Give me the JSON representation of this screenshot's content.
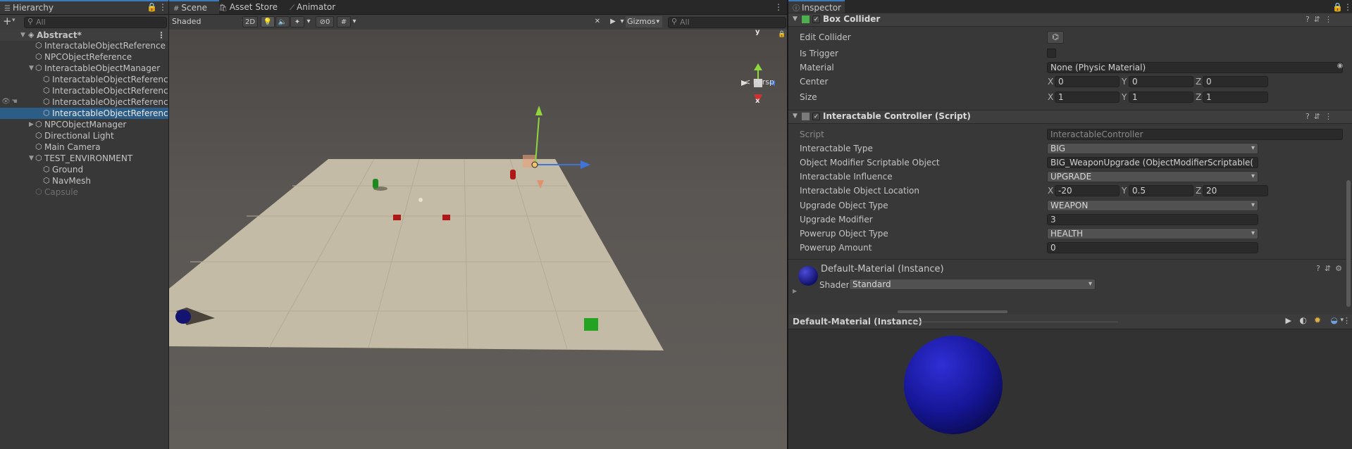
{
  "hierarchy": {
    "tab": "Hierarchy",
    "add": "+",
    "add_caret": "▾",
    "search_placeholder": "All",
    "scene_name": "Abstract*",
    "items": [
      {
        "label": "InteractableObjectReference"
      },
      {
        "label": "NPCObjectReference"
      },
      {
        "label": "InteractableObjectManager"
      },
      {
        "label": "InteractableObjectReference(Clone)"
      },
      {
        "label": "InteractableObjectReference(Clone)"
      },
      {
        "label": "InteractableObjectReference(Clone)"
      },
      {
        "label": "InteractableObjectReference(Clone)"
      },
      {
        "label": "NPCObjectManager"
      },
      {
        "label": "Directional Light"
      },
      {
        "label": "Main Camera"
      },
      {
        "label": "TEST_ENVIRONMENT"
      },
      {
        "label": "Ground"
      },
      {
        "label": "NavMesh"
      },
      {
        "label": "Capsule"
      }
    ]
  },
  "scene": {
    "tabs": [
      {
        "label": "Scene",
        "icon": "#"
      },
      {
        "label": "Asset Store",
        "icon": "🛍"
      },
      {
        "label": "Animator",
        "icon": "⟋"
      }
    ],
    "shading_mode": "Shaded",
    "mode_2d": "2D",
    "hidden_count": "0",
    "gizmos_label": "Gizmos",
    "search_placeholder": "All",
    "persp_label": "< Persp",
    "axis_y": "y",
    "axis_x": "x"
  },
  "inspector": {
    "tab": "Inspector",
    "box_collider": {
      "title": "Box Collider",
      "edit_collider_label": "Edit Collider",
      "is_trigger_label": "Is Trigger",
      "material_label": "Material",
      "material_value": "None (Physic Material)",
      "center_label": "Center",
      "center": {
        "x": "0",
        "y": "0",
        "z": "0"
      },
      "size_label": "Size",
      "size": {
        "x": "1",
        "y": "1",
        "z": "1"
      }
    },
    "controller": {
      "title": "Interactable Controller (Script)",
      "script_label": "Script",
      "script_value": "InteractableController",
      "type_label": "Interactable Type",
      "type_value": "BIG",
      "modifier_label": "Object Modifier Scriptable Object",
      "modifier_value": "BIG_WeaponUpgrade (ObjectModifierScriptable(",
      "influence_label": "Interactable Influence",
      "influence_value": "UPGRADE",
      "location_label": "Interactable Object Location",
      "location": {
        "x": "-20",
        "y": "0.5",
        "z": "20"
      },
      "upgrade_type_label": "Upgrade Object Type",
      "upgrade_type_value": "WEAPON",
      "upgrade_mod_label": "Upgrade Modifier",
      "upgrade_mod_value": "3",
      "powerup_type_label": "Powerup Object Type",
      "powerup_type_value": "HEALTH",
      "powerup_amount_label": "Powerup Amount",
      "powerup_amount_value": "0"
    },
    "material": {
      "title": "Default-Material (Instance)",
      "shader_label": "Shader",
      "shader_value": "Standard"
    },
    "preview": {
      "title": "Default-Material (Instance)"
    },
    "axis_labels": {
      "x": "X",
      "y": "Y",
      "z": "Z"
    }
  },
  "colors": {
    "selection": "#2c5d87",
    "panel_bg": "#383838",
    "ground": "#c4bca6",
    "sphere": "#1a1a9a"
  }
}
